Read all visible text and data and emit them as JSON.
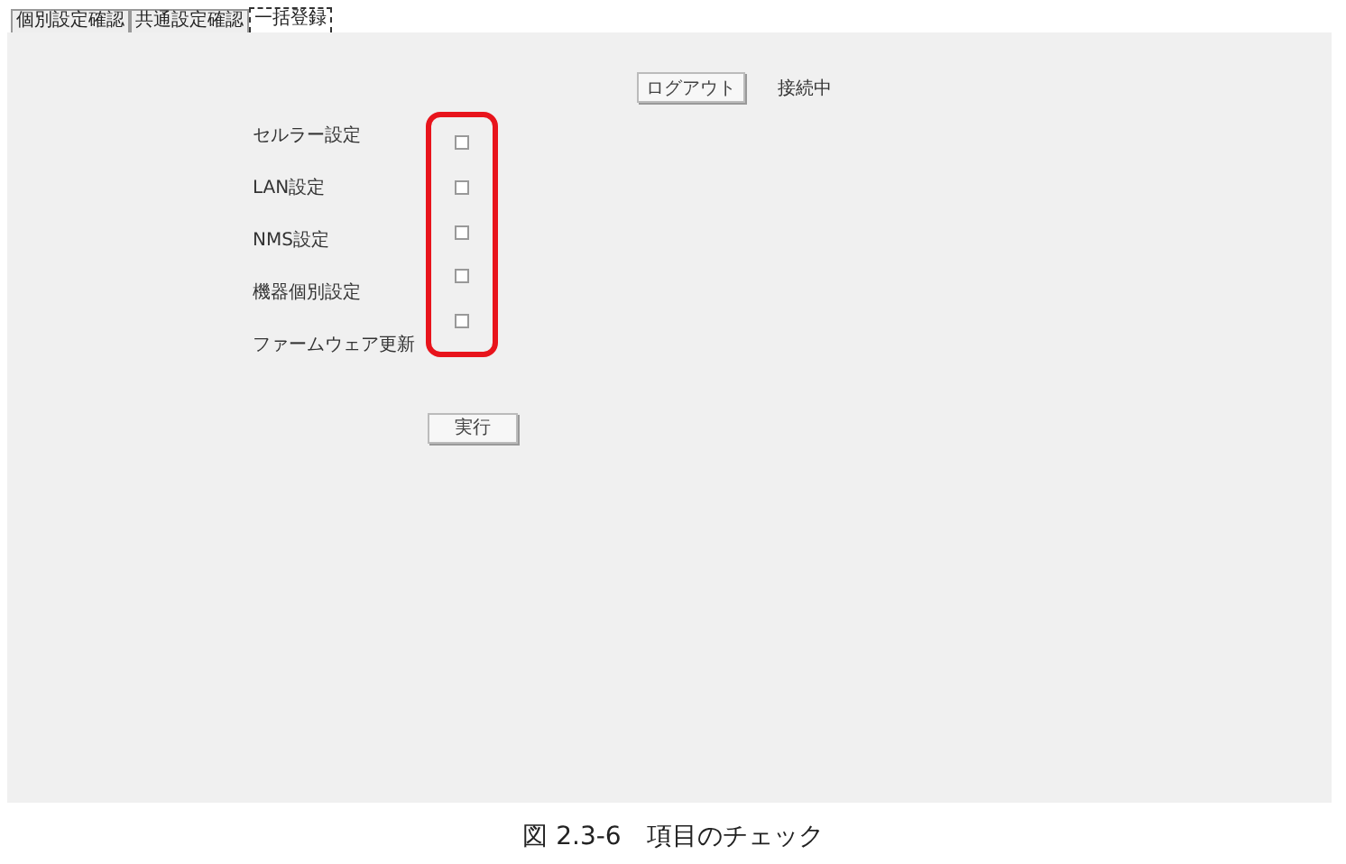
{
  "tabs": [
    {
      "label": "個別設定確認",
      "selected": false
    },
    {
      "label": "共通設定確認",
      "selected": false
    },
    {
      "label": "一括登録",
      "selected": true
    }
  ],
  "logout_button": "ログアウト",
  "status": "接続中",
  "items": [
    {
      "label": "セルラー設定",
      "checked": false
    },
    {
      "label": "LAN設定",
      "checked": false
    },
    {
      "label": "NMS設定",
      "checked": false
    },
    {
      "label": "機器個別設定",
      "checked": false
    },
    {
      "label": "ファームウェア更新",
      "checked": false
    }
  ],
  "execute_button": "実行",
  "caption": "図 2.3-6　項目のチェック"
}
